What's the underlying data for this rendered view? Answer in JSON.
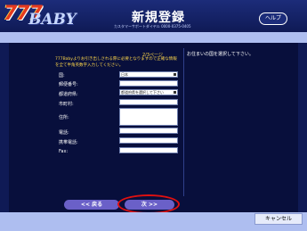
{
  "header": {
    "logo_number": "777",
    "logo_word": "BABY",
    "title": "新規登録",
    "support_line": "カスタマーサポートダイヤル 0000-0375-0405",
    "help_label": "ヘルプ"
  },
  "form": {
    "page_indicator": "2/3ページ",
    "notice": "777Babyよりお引き出しされる際に必要となりますので正確な情報を全て半角英数字入力してください。",
    "hint": "お住まいの国を選択して下さい。",
    "fields": [
      {
        "label": "国:",
        "value": "日本",
        "type": "select"
      },
      {
        "label": "郵便番号:",
        "value": "",
        "type": "text"
      },
      {
        "label": "都道府県:",
        "value": "都道府県を選択して下さい",
        "type": "select"
      },
      {
        "label": "市町村:",
        "value": "",
        "type": "text"
      },
      {
        "label": "住所:",
        "value": "",
        "type": "textarea"
      },
      {
        "label": "電話:",
        "value": "",
        "type": "text"
      },
      {
        "label": "携帯電話:",
        "value": "",
        "type": "text"
      },
      {
        "label": "Fax:",
        "value": "",
        "type": "text"
      }
    ]
  },
  "navigation": {
    "back_label": "<< 戻る",
    "next_label": "次 >>"
  },
  "footer": {
    "cancel_label": "キャンセル"
  }
}
